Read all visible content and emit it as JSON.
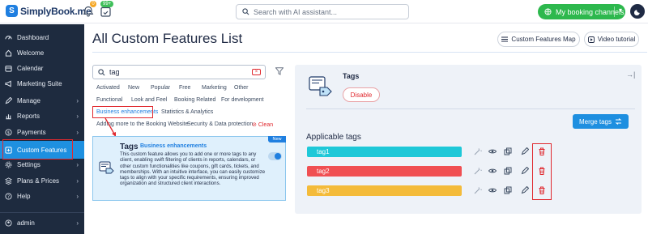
{
  "app": {
    "logo_text": "SimplyBook.me",
    "notif_badge": "0",
    "cal_badge": "99+",
    "search_placeholder": "Search with AI assistant...",
    "booking_button": "My booking channels"
  },
  "sidebar": {
    "items": [
      {
        "label": "Dashboard"
      },
      {
        "label": "Welcome"
      },
      {
        "label": "Calendar"
      },
      {
        "label": "Marketing Suite"
      },
      {
        "label": "Manage"
      },
      {
        "label": "Reports"
      },
      {
        "label": "Payments"
      },
      {
        "label": "Custom Features"
      },
      {
        "label": "Settings"
      },
      {
        "label": "Plans & Prices"
      },
      {
        "label": "Help"
      }
    ],
    "user": "admin"
  },
  "main": {
    "title": "All Custom Features List",
    "map_button": "Custom Features Map",
    "video_button": "Video tutorial"
  },
  "filter": {
    "search_value": "tag",
    "clear": "×",
    "tags": [
      "Activated",
      "New",
      "Popular",
      "Free",
      "Marketing",
      "Other",
      "Functional",
      "Look and Feel",
      "Booking Related",
      "For development",
      "Business enhancements",
      "Statistics & Analytics",
      "Adding more to the Booking Website",
      "Security & Data protection"
    ],
    "clean": "Clean"
  },
  "card": {
    "badge": "New",
    "title": "Tags",
    "category": "Business enhancements",
    "description": "This custom feature allows you to add one or more tags to any client, enabling swift filtering of clients in reports, calendars, or other custom functionalities like coupons, gift cards, tickets, and memberships. With an intuitive interface, you can easily customize tags to align with your specific requirements, ensuring improved organization and structured client interactions."
  },
  "detail": {
    "title": "Tags",
    "disable_button": "Disable",
    "merge_button": "Merge tags",
    "applicable_label": "Applicable tags",
    "tags": [
      {
        "name": "tag1",
        "color": "#1ec8d8"
      },
      {
        "name": "tag2",
        "color": "#f04f52"
      },
      {
        "name": "tag3",
        "color": "#f4bb3a"
      }
    ]
  },
  "colors": {
    "sidebar": "#1e2b3f",
    "active": "#1e90e0",
    "highlight": "#e0282e",
    "accent": "#2db84d"
  }
}
